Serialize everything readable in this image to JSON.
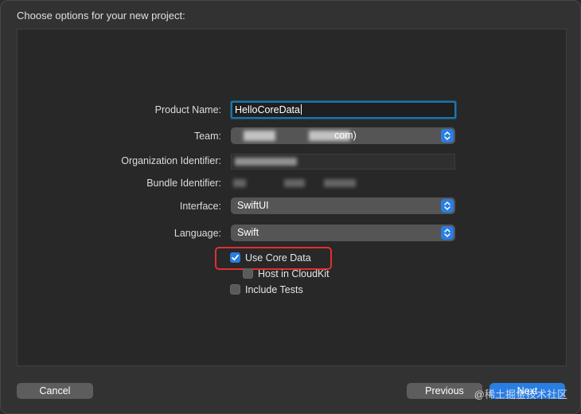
{
  "window": {
    "title": "Choose options for your new project:"
  },
  "form": {
    "product_name_label": "Product Name:",
    "product_name_value": "HelloCoreData",
    "team_label": "Team:",
    "team_value_suffix": "com)",
    "org_id_label": "Organization Identifier:",
    "bundle_id_label": "Bundle Identifier:",
    "interface_label": "Interface:",
    "interface_value": "SwiftUI",
    "language_label": "Language:",
    "language_value": "Swift"
  },
  "options": {
    "use_core_data": {
      "label": "Use Core Data",
      "checked": true
    },
    "host_in_cloudkit": {
      "label": "Host in CloudKit",
      "checked": false
    },
    "include_tests": {
      "label": "Include Tests",
      "checked": false
    }
  },
  "buttons": {
    "cancel": "Cancel",
    "previous": "Previous",
    "next": "Next"
  },
  "watermark": "@稀土掘金技术社区",
  "colors": {
    "accent": "#2a7de1",
    "focus_ring": "#1e76a8",
    "highlight_box": "#e03030"
  },
  "icons": {
    "popup_stepper": "chevron-up-down-icon",
    "checkmark": "checkmark-icon"
  }
}
